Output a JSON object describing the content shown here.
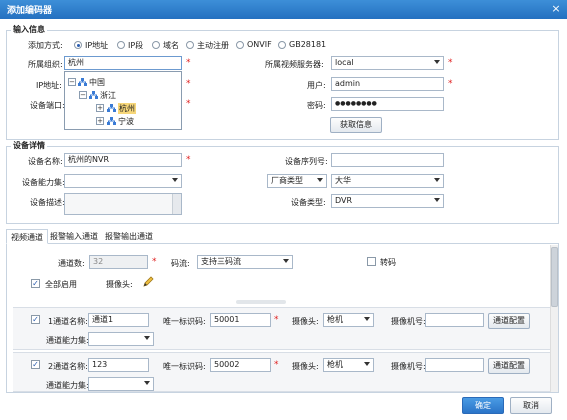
{
  "dialog": {
    "title": "添加编码器",
    "close": "×"
  },
  "input_info": {
    "legend": "输入信息",
    "add_mode_label": "添加方式:",
    "modes": [
      "IP地址",
      "IP段",
      "域名",
      "主动注册",
      "ONVIF",
      "GB28181"
    ],
    "selected_mode": "IP地址",
    "org_label": "所属组织:",
    "org_value": "杭州",
    "ip_label": "IP地址:",
    "port_label": "设备端口:",
    "server_label": "所属视频服务器:",
    "server_value": "local",
    "user_label": "用户:",
    "user_value": "admin",
    "pwd_label": "密码:",
    "pwd_value": "●●●●●●●●",
    "fetch_button": "获取信息",
    "tree": {
      "root": "中国",
      "child": "浙江",
      "leaf1": "杭州",
      "leaf2": "宁波"
    }
  },
  "device_detail": {
    "legend": "设备详情",
    "name_label": "设备名称:",
    "name_value": "杭州的NVR",
    "capability_label": "设备能力集:",
    "desc_label": "设备描述:",
    "serial_label": "设备序列号:",
    "vendor_label": "厂商类型",
    "vendor_value": "大华",
    "type_label": "设备类型:",
    "type_value": "DVR"
  },
  "tabs": [
    "视频通道",
    "报警输入通道",
    "报警输出通道"
  ],
  "video_channel": {
    "count_label": "通道数:",
    "count_value": "32",
    "stream_label": "码流:",
    "stream_value": "支持三码流",
    "transcode_label": "转码",
    "enable_all_label": "全部启用",
    "camera_label": "摄像头:"
  },
  "channels": [
    {
      "index_label": "1通道名称:",
      "name": "通道1",
      "uid_label": "唯一标识码:",
      "uid": "50001",
      "cam_label": "摄像头:",
      "cam": "枪机",
      "camno_label": "摄像机号:",
      "config": "通道配置",
      "cap_label": "通道能力集:"
    },
    {
      "index_label": "2通道名称:",
      "name": "123",
      "uid_label": "唯一标识码:",
      "uid": "50002",
      "cam_label": "摄像头:",
      "cam": "枪机",
      "camno_label": "摄像机号:",
      "config": "通道配置",
      "cap_label": "通道能力集:"
    }
  ],
  "footer": {
    "ok": "确定",
    "cancel": "取消"
  }
}
